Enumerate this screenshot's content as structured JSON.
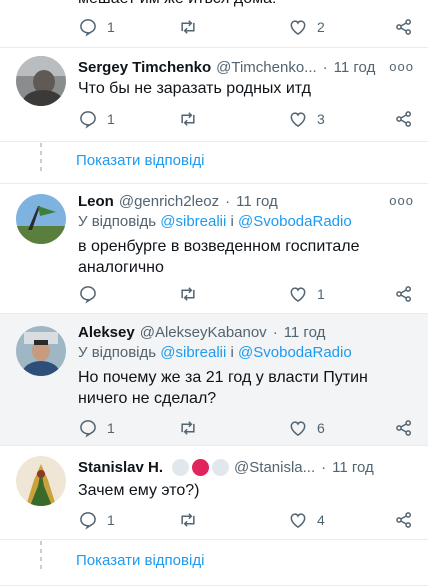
{
  "top_tweet": {
    "cut_text": "мешает им же иться дома!",
    "reply_count": "1",
    "like_count": "2"
  },
  "tweets": [
    {
      "name": "Sergey Timchenko",
      "handle": "@Timchenko...",
      "time": "11 год",
      "body": "Что бы не заразать родных итд",
      "reply_count": "1",
      "retweet_count": "",
      "like_count": "3"
    },
    {
      "name": "Leon",
      "handle": "@genrich2leoz",
      "time": "11 год",
      "replying_prefix": "У відповідь",
      "replying_to_1": "@sibrealii",
      "replying_sep": "і",
      "replying_to_2": "@SvobodaRadio",
      "body": "в оренбурге в возведенном госпитале аналогично",
      "reply_count": "",
      "like_count": "1"
    },
    {
      "name": "Aleksey",
      "handle": "@AlekseyKabanov",
      "time": "11 год",
      "replying_prefix": "У відповідь",
      "replying_to_1": "@sibrealii",
      "replying_sep": "і",
      "replying_to_2": "@SvobodaRadio",
      "body": "Но почему же за 21 год у власти Путин ничего не сделал?",
      "reply_count": "1",
      "like_count": "6"
    },
    {
      "name": "Stanislav H.",
      "handle": "@Stanisla...",
      "time": "11 год",
      "body": "Зачем ему это?)",
      "reply_count": "1",
      "like_count": "4"
    }
  ],
  "show_replies_label": "Показати відповіді",
  "separator": "·",
  "more_glyph": "ooo",
  "colors": {
    "link": "#1d9bf0",
    "muted": "#536471",
    "highlight_bg": "#f2f4f5"
  }
}
